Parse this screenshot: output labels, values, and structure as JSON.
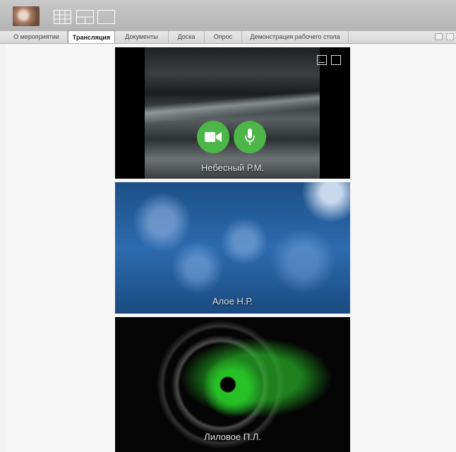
{
  "toolbar": {
    "avatar_icon": "user-photo",
    "layout_buttons": [
      "grid-layout-icon",
      "split-layout-icon",
      "single-layout-icon"
    ]
  },
  "tabs": [
    {
      "label": "О мероприятии",
      "active": false
    },
    {
      "label": "Трансляция",
      "active": true
    },
    {
      "label": "Документы",
      "active": false
    },
    {
      "label": "Доска",
      "active": false
    },
    {
      "label": "Опрос",
      "active": false
    },
    {
      "label": "Демонстрация рабочего стола",
      "active": false
    }
  ],
  "participants": [
    {
      "name": "Небесный Р.М.",
      "controls": [
        "camera-icon",
        "microphone-icon"
      ]
    },
    {
      "name": "Алое Н.Р."
    },
    {
      "name": "Лиловое П.Л."
    }
  ],
  "colors": {
    "accent_green": "#4cb648",
    "topbar": "#bdbdbd",
    "tab_bar": "#dedede"
  }
}
